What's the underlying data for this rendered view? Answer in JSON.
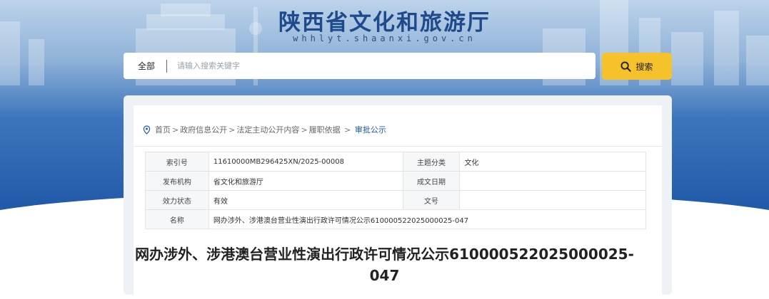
{
  "header": {
    "site_title": "陕西省文化和旅游厅",
    "site_domain": "whhlyt.shaanxi.gov.cn"
  },
  "search": {
    "scope_label": "全部",
    "placeholder": "请输入搜索关键字",
    "button_label": "搜索"
  },
  "breadcrumb": {
    "items": [
      "首页",
      "政府信息公开",
      "法定主动公开内容",
      "履职依据"
    ],
    "current": "审批公示"
  },
  "meta_table": {
    "index_label": "索引号",
    "index_value": "11610000MB296425XN/2025-00008",
    "topic_label": "主题分类",
    "topic_value": "文化",
    "publisher_label": "发布机构",
    "publisher_value": "省文化和旅游厅",
    "date_label": "成文日期",
    "date_value": "",
    "status_label": "效力状态",
    "status_value": "有效",
    "docno_label": "文号",
    "docno_value": "",
    "name_label": "名称",
    "name_value": "网办涉外、涉港澳台营业性演出行政许可情况公示610000522025000025-047"
  },
  "document": {
    "title_line1": "网办涉外、涉港澳台营业性演出行政许可情况公示610000522025000025-",
    "title_line2": "047"
  },
  "colors": {
    "accent_blue": "#1f58a8",
    "search_button": "#f6c22b",
    "title_blue": "#1e4a8c"
  }
}
